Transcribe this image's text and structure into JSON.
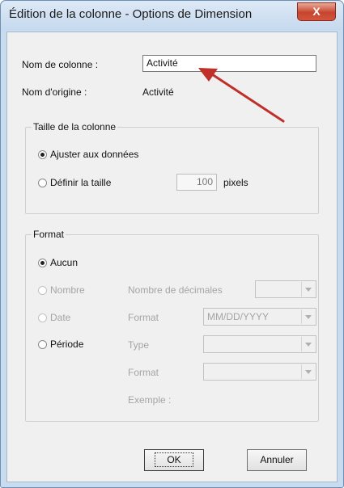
{
  "window": {
    "title": "Édition de la colonne - Options de Dimension",
    "close_label": "X"
  },
  "fields": {
    "column_name_label": "Nom de colonne :",
    "column_name_value": "Activité",
    "origin_name_label": "Nom d'origine :",
    "origin_name_value": "Activité"
  },
  "size_group": {
    "title": "Taille de la colonne",
    "option_fit": "Ajuster aux données",
    "option_set": "Définir la taille",
    "size_value": "100",
    "size_unit": "pixels",
    "selected": "Ajuster aux données"
  },
  "format_group": {
    "title": "Format",
    "option_none": "Aucun",
    "option_number": "Nombre",
    "option_date": "Date",
    "option_period": "Période",
    "selected": "Aucun",
    "decimals_label": "Nombre de décimales",
    "decimals_value": "",
    "date_format_label": "Format",
    "date_format_value": "MM/DD/YYYY",
    "type_label": "Type",
    "type_value": "",
    "period_format_label": "Format",
    "period_format_value": "",
    "example_label": "Exemple :"
  },
  "buttons": {
    "ok": "OK",
    "cancel": "Annuler"
  },
  "colors": {
    "annotation_arrow": "#c0302b"
  }
}
